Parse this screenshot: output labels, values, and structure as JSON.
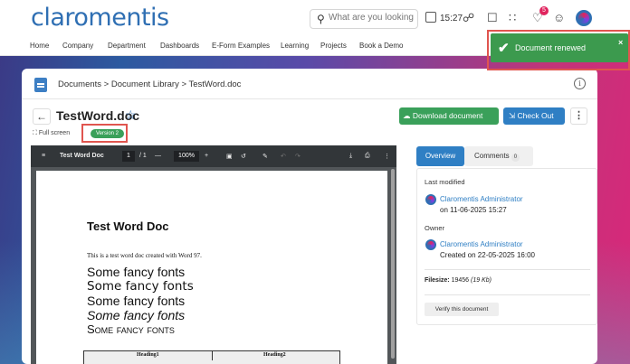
{
  "brand": {
    "logo": "claromentis"
  },
  "topbar": {
    "search_placeholder": "What are you looking fo",
    "time": "15:27",
    "notification_count": "5"
  },
  "nav": [
    "Home",
    "Company",
    "Department",
    "Dashboards",
    "E-Form Examples",
    "Learning",
    "Projects",
    "Book a Demo"
  ],
  "breadcrumb": "Documents > Document Library > TestWord.doc",
  "document": {
    "title": "TestWord.doc",
    "full_screen_label": "Full screen",
    "version_label": "Version 2"
  },
  "actions": {
    "download_label": "Download document",
    "checkout_label": "Check Out",
    "more_label": "⋮"
  },
  "viewer": {
    "doc_name": "Test Word Doc",
    "page_current": "1",
    "page_total": "/ 1",
    "zoom": "100%"
  },
  "pdf_page": {
    "heading": "Test Word Doc",
    "paragraph": "This is a test word doc created with Word 97.",
    "fancy_lines": [
      "Some fancy fonts",
      "Some fancy fonts",
      "Some fancy fonts",
      "Some fancy fonts",
      "Some fancy fonts"
    ],
    "table_headers": [
      "Heading1",
      "Heading2"
    ]
  },
  "details": {
    "tab_overview": "Overview",
    "tab_comments": "Comments",
    "comments_count": "0",
    "last_modified_label": "Last modified",
    "modifier_name": "Claromentis Administrator",
    "modified_on": "on 11-06-2025 15:27",
    "owner_label": "Owner",
    "owner_name": "Claromentis Administrator",
    "created_on": "Created on 22-05-2025 16:00",
    "filesize_label": "Filesize:",
    "filesize_value": "19456",
    "filesize_kb": "(19 Kb)",
    "verify_label": "Verify this document"
  },
  "toast": {
    "message": "Document renewed",
    "close": "×"
  },
  "colors": {
    "brand_blue": "#2f6fb3",
    "success_green": "#3aa05a",
    "primary_button": "#2f7fc4",
    "highlight_red": "#e0554f"
  }
}
